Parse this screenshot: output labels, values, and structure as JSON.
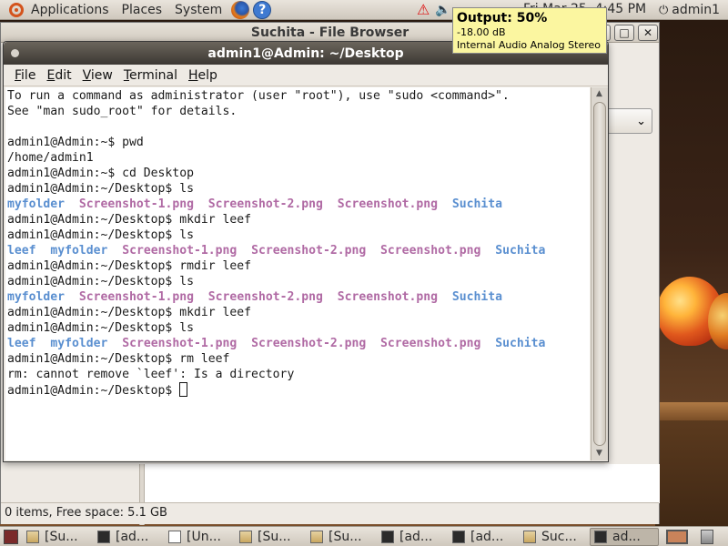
{
  "top_panel": {
    "menus": [
      "Applications",
      "Places",
      "System"
    ],
    "clock": "Fri Mar 25, 4:45 PM",
    "user": "admin1"
  },
  "volume_tooltip": {
    "title": "Output: 50%",
    "level": "-18.00 dB",
    "device": "Internal Audio Analog Stereo"
  },
  "file_browser": {
    "title": "Suchita - File Browser",
    "status": "0 items, Free space: 5.1 GB"
  },
  "terminal": {
    "title": "admin1@Admin: ~/Desktop",
    "menu": [
      {
        "mnemonic": "F",
        "rest": "ile"
      },
      {
        "mnemonic": "E",
        "rest": "dit"
      },
      {
        "mnemonic": "V",
        "rest": "iew"
      },
      {
        "mnemonic": "T",
        "rest": "erminal"
      },
      {
        "mnemonic": "H",
        "rest": "elp"
      }
    ],
    "lines": [
      {
        "type": "text",
        "text": "To run a command as administrator (user \"root\"), use \"sudo <command>\"."
      },
      {
        "type": "text",
        "text": "See \"man sudo_root\" for details."
      },
      {
        "type": "text",
        "text": ""
      },
      {
        "type": "text",
        "text": "admin1@Admin:~$ pwd"
      },
      {
        "type": "text",
        "text": "/home/admin1"
      },
      {
        "type": "text",
        "text": "admin1@Admin:~$ cd Desktop"
      },
      {
        "type": "text",
        "text": "admin1@Admin:~/Desktop$ ls"
      },
      {
        "type": "ls",
        "items": [
          {
            "name": "myfolder",
            "kind": "dir",
            "col": 0
          },
          {
            "name": "Screenshot-1.png",
            "kind": "img",
            "col": 10
          },
          {
            "name": "Screenshot-2.png",
            "kind": "img",
            "col": 28
          },
          {
            "name": "Screenshot.png",
            "kind": "img",
            "col": 46
          },
          {
            "name": "Suchita",
            "kind": "dir",
            "col": 62
          }
        ]
      },
      {
        "type": "text",
        "text": "admin1@Admin:~/Desktop$ mkdir leef"
      },
      {
        "type": "text",
        "text": "admin1@Admin:~/Desktop$ ls"
      },
      {
        "type": "ls",
        "items": [
          {
            "name": "leef",
            "kind": "dir",
            "col": 0
          },
          {
            "name": "myfolder",
            "kind": "dir",
            "col": 6
          },
          {
            "name": "Screenshot-1.png",
            "kind": "img",
            "col": 16
          },
          {
            "name": "Screenshot-2.png",
            "kind": "img",
            "col": 34
          },
          {
            "name": "Screenshot.png",
            "kind": "img",
            "col": 52
          },
          {
            "name": "Suchita",
            "kind": "dir",
            "col": 68
          }
        ]
      },
      {
        "type": "text",
        "text": "admin1@Admin:~/Desktop$ rmdir leef"
      },
      {
        "type": "text",
        "text": "admin1@Admin:~/Desktop$ ls"
      },
      {
        "type": "ls",
        "items": [
          {
            "name": "myfolder",
            "kind": "dir",
            "col": 0
          },
          {
            "name": "Screenshot-1.png",
            "kind": "img",
            "col": 10
          },
          {
            "name": "Screenshot-2.png",
            "kind": "img",
            "col": 28
          },
          {
            "name": "Screenshot.png",
            "kind": "img",
            "col": 46
          },
          {
            "name": "Suchita",
            "kind": "dir",
            "col": 62
          }
        ]
      },
      {
        "type": "text",
        "text": "admin1@Admin:~/Desktop$ mkdir leef"
      },
      {
        "type": "text",
        "text": "admin1@Admin:~/Desktop$ ls"
      },
      {
        "type": "ls",
        "items": [
          {
            "name": "leef",
            "kind": "dir",
            "col": 0
          },
          {
            "name": "myfolder",
            "kind": "dir",
            "col": 6
          },
          {
            "name": "Screenshot-1.png",
            "kind": "img",
            "col": 16
          },
          {
            "name": "Screenshot-2.png",
            "kind": "img",
            "col": 34
          },
          {
            "name": "Screenshot.png",
            "kind": "img",
            "col": 52
          },
          {
            "name": "Suchita",
            "kind": "dir",
            "col": 68
          }
        ]
      },
      {
        "type": "text",
        "text": "admin1@Admin:~/Desktop$ rm leef"
      },
      {
        "type": "text",
        "text": "rm: cannot remove `leef': Is a directory"
      },
      {
        "type": "prompt",
        "text": "admin1@Admin:~/Desktop$ "
      }
    ]
  },
  "taskbar": {
    "tasks": [
      {
        "label": "[Su...",
        "icon": "folder",
        "active": false
      },
      {
        "label": "[ad...",
        "icon": "terminal",
        "active": false
      },
      {
        "label": "[Un...",
        "icon": "document",
        "active": false
      },
      {
        "label": "[Su...",
        "icon": "folder",
        "active": false
      },
      {
        "label": "[Su...",
        "icon": "folder",
        "active": false
      },
      {
        "label": "[ad...",
        "icon": "terminal",
        "active": false
      },
      {
        "label": "[ad...",
        "icon": "terminal",
        "active": false
      },
      {
        "label": "Suc...",
        "icon": "folder",
        "active": false
      },
      {
        "label": "ad...",
        "icon": "terminal",
        "active": true
      }
    ]
  },
  "colors": {
    "ls_dir": "#5a8fd0",
    "ls_img": "#b06aa4",
    "panel": "#e0dad1",
    "terminal_title_bg": "#4a4640"
  }
}
